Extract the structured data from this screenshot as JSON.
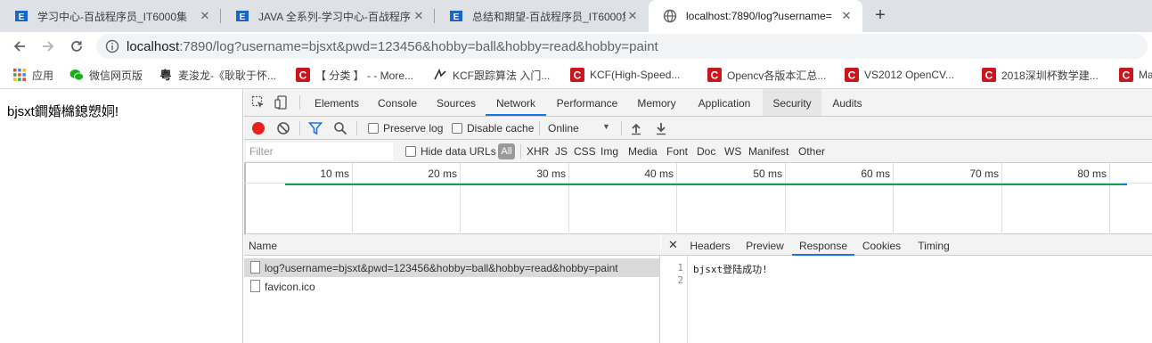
{
  "tabs": [
    {
      "title": "学习中心-百战程序员_IT6000集",
      "close": "✕",
      "favicon": "sxt-logo-icon"
    },
    {
      "title": "JAVA 全系列-学习中心-百战程序",
      "close": "✕",
      "favicon": "sxt-logo-icon"
    },
    {
      "title": "总结和期望-百战程序员_IT6000集",
      "close": "✕",
      "favicon": "sxt-logo-icon"
    },
    {
      "title": "localhost:7890/log?username=",
      "close": "✕",
      "favicon": "globe-icon"
    }
  ],
  "new_tab_label": "+",
  "address": {
    "host": "localhost",
    "rest": ":7890/log?username=bjsxt&pwd=123456&hobby=ball&hobby=read&hobby=paint"
  },
  "bookmarks": [
    {
      "label": "应用",
      "icon": "apps-grid-icon"
    },
    {
      "label": "微信网页版",
      "icon": "wechat-icon"
    },
    {
      "label": "麦浚龙-《耿耿于怀...",
      "icon": "music-icon"
    },
    {
      "label": "【 分类 】 - - More...",
      "icon": "csdn-icon"
    },
    {
      "label": "KCF跟踪算法 入门...",
      "icon": "kcf-icon"
    },
    {
      "label": "KCF(High-Speed...",
      "icon": "csdn-icon"
    },
    {
      "label": "Opencv各版本汇总...",
      "icon": "csdn-icon"
    },
    {
      "label": "VS2012 OpenCV...",
      "icon": "csdn-icon"
    },
    {
      "label": "2018深圳杯数学建...",
      "icon": "csdn-icon"
    },
    {
      "label": "Ma",
      "icon": "csdn-icon"
    }
  ],
  "page": {
    "text": "bjsxt鐧婚檰鎴愬姛!"
  },
  "devtools": {
    "tabs": [
      "Elements",
      "Console",
      "Sources",
      "Network",
      "Performance",
      "Memory",
      "Application",
      "Security",
      "Audits"
    ],
    "selected_tab": "Network",
    "controls": {
      "preserve_log": "Preserve log",
      "disable_cache": "Disable cache",
      "throttle": "Online",
      "throttle_arrow": "▼"
    },
    "filter": {
      "placeholder": "Filter",
      "hide_data_urls": "Hide data URLs",
      "all": "All",
      "types": [
        "XHR",
        "JS",
        "CSS",
        "Img",
        "Media",
        "Font",
        "Doc",
        "WS",
        "Manifest",
        "Other"
      ]
    },
    "timeline": {
      "ticks": [
        "10 ms",
        "20 ms",
        "30 ms",
        "40 ms",
        "50 ms",
        "60 ms",
        "70 ms",
        "80 ms"
      ]
    },
    "requests": {
      "header": "Name",
      "rows": [
        "log?username=bjsxt&pwd=123456&hobby=ball&hobby=read&hobby=paint",
        "favicon.ico"
      ]
    },
    "detail": {
      "close": "✕",
      "tabs": [
        "Headers",
        "Preview",
        "Response",
        "Cookies",
        "Timing"
      ],
      "selected_tab": "Response",
      "line_numbers": [
        "1",
        "2"
      ],
      "response": "bjsxt登陆成功!"
    }
  },
  "colors": {
    "accent": "#1a73e8",
    "record": "#e8201a",
    "csdn": "#c9151e",
    "wechat": "#1aad19"
  }
}
